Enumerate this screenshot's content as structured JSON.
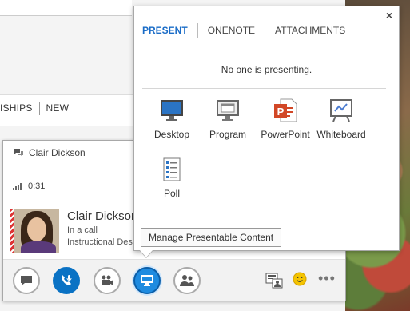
{
  "background": {
    "nav_items": [
      "ISHIPS",
      "NEW"
    ]
  },
  "popup": {
    "tabs": [
      {
        "label": "PRESENT",
        "active": true
      },
      {
        "label": "ONENOTE",
        "active": false
      },
      {
        "label": "ATTACHMENTS",
        "active": false
      }
    ],
    "close_label": "×",
    "status_text": "No one is presenting.",
    "options": [
      {
        "label": "Desktop",
        "icon": "desktop-icon"
      },
      {
        "label": "Program",
        "icon": "program-icon"
      },
      {
        "label": "PowerPoint",
        "icon": "powerpoint-icon"
      },
      {
        "label": "Whiteboard",
        "icon": "whiteboard-icon"
      },
      {
        "label": "Poll",
        "icon": "poll-icon"
      }
    ],
    "manage_button": "Manage Presentable Content"
  },
  "conversation": {
    "title": "Clair Dickson",
    "timer": "0:31",
    "contact": {
      "name": "Clair Dickson",
      "status": "In a call",
      "role": "Instructional Designer"
    },
    "toolbar": {
      "more_label": "•••"
    }
  },
  "colors": {
    "accent": "#1a6cc7",
    "call_blue": "#0a72c4",
    "present_selected": "#1e8be0",
    "powerpoint_orange": "#d24726"
  }
}
